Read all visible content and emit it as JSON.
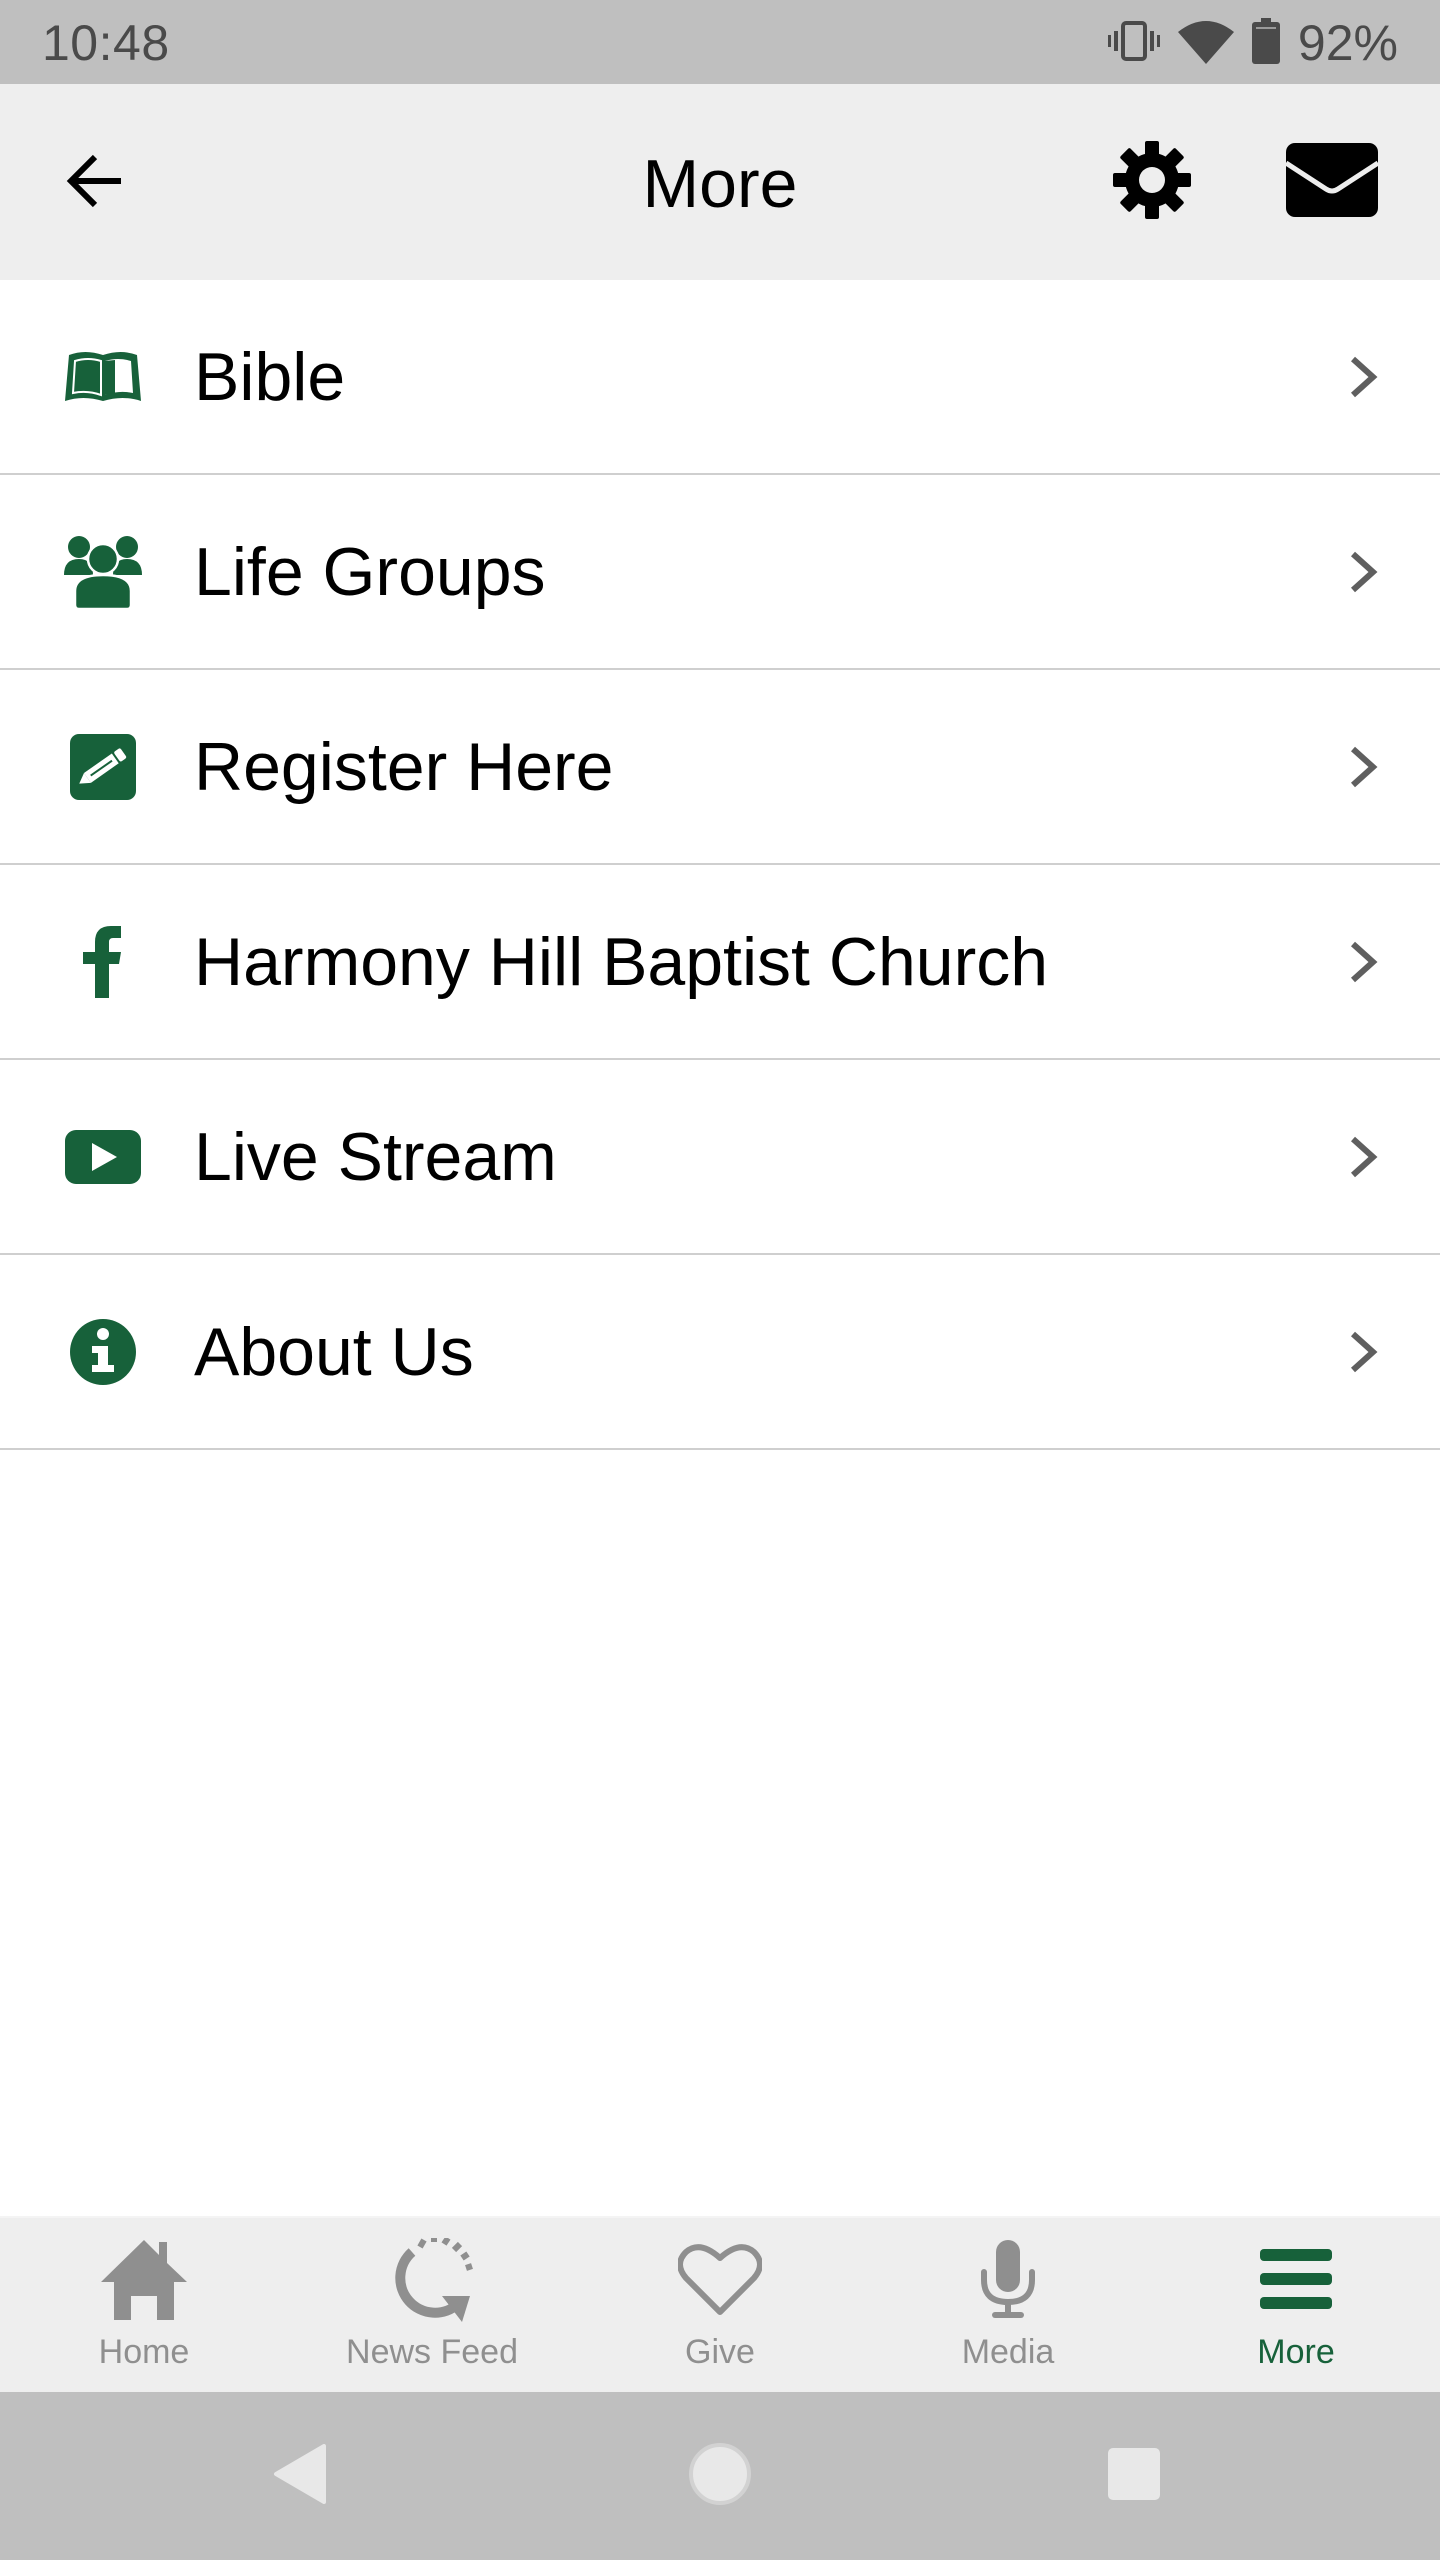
{
  "status_bar": {
    "time": "10:48",
    "battery_percent": "92%",
    "icons": [
      "vibrate-icon",
      "wifi-icon",
      "battery-icon"
    ]
  },
  "header": {
    "title": "More",
    "back_icon": "arrow-left-icon",
    "settings_icon": "gear-icon",
    "messages_icon": "envelope-icon"
  },
  "colors": {
    "accent": "#17613a",
    "inactive_tab": "#8f8f8f",
    "header_bg": "#eeeeee",
    "status_bar_bg": "#bfbfbf",
    "divider": "#cfcfcf",
    "chevron": "#5f5f5f"
  },
  "menu": {
    "items": [
      {
        "label": "Bible",
        "icon": "open-book-icon"
      },
      {
        "label": "Life Groups",
        "icon": "users-icon"
      },
      {
        "label": "Register Here",
        "icon": "pencil-square-icon"
      },
      {
        "label": "Harmony Hill Baptist Church",
        "icon": "facebook-icon"
      },
      {
        "label": "Live Stream",
        "icon": "youtube-play-icon"
      },
      {
        "label": "About Us",
        "icon": "info-circle-icon"
      }
    ]
  },
  "tab_bar": {
    "tabs": [
      {
        "label": "Home",
        "icon": "home-icon",
        "active": false
      },
      {
        "label": "News Feed",
        "icon": "refresh-feed-icon",
        "active": false
      },
      {
        "label": "Give",
        "icon": "heart-outline-icon",
        "active": false
      },
      {
        "label": "Media",
        "icon": "microphone-icon",
        "active": false
      },
      {
        "label": "More",
        "icon": "hamburger-menu-icon",
        "active": true
      }
    ]
  },
  "system_nav": {
    "buttons": [
      "back-triangle-icon",
      "home-circle-icon",
      "recents-square-icon"
    ]
  }
}
